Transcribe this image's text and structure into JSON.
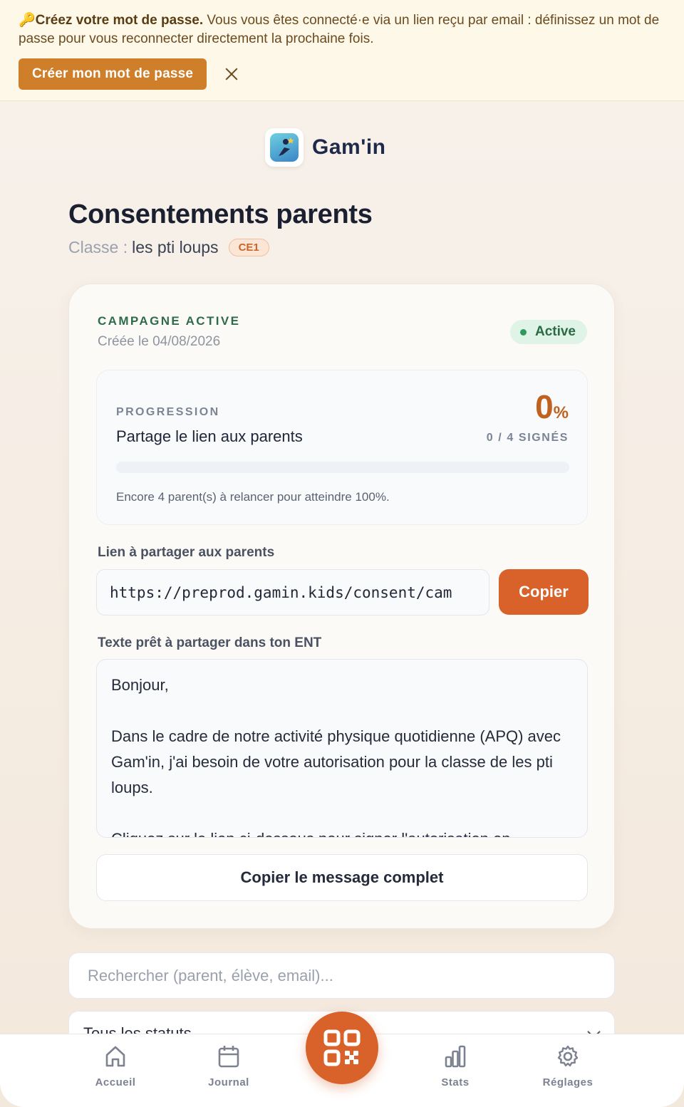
{
  "banner": {
    "emoji": "🔑",
    "title": "Créez votre mot de passe.",
    "text": " Vous vous êtes connecté·e via un lien reçu par email : définissez un mot de passe pour vous reconnecter directement la prochaine fois.",
    "button": "Créer mon mot de passe"
  },
  "logo": {
    "name": "Gam'in"
  },
  "page": {
    "title": "Consentements parents",
    "class_prefix": "Classe :",
    "class_name": "les pti loups",
    "class_level": "CE1"
  },
  "campaign": {
    "label": "CAMPAGNE ACTIVE",
    "created": "Créée le 04/08/2026",
    "status": "Active",
    "progress": {
      "label": "PROGRESSION",
      "title": "Partage le lien aux parents",
      "percent": "0",
      "percent_sign": "%",
      "fraction": 0,
      "count": "0 / 4 SIGNÉS",
      "hint": "Encore 4 parent(s) à relancer pour atteindre 100%."
    },
    "link_label": "Lien à partager aux parents",
    "link_value": "https://preprod.gamin.kids/consent/cam",
    "copy_button": "Copier",
    "text_label": "Texte prêt à partager dans ton ENT",
    "message": "Bonjour,\n\nDans le cadre de notre activité physique quotidienne (APQ) avec Gam'in, j'ai besoin de votre autorisation pour la classe de les pti loups.\n\nCliquez sur le lien ci-dessous pour signer l'autorisation en",
    "copy_message_button": "Copier le message complet"
  },
  "search": {
    "placeholder": "Rechercher (parent, élève, email)..."
  },
  "filter": {
    "value": "Tous les statuts"
  },
  "nav": {
    "home": "Accueil",
    "journal": "Journal",
    "stats": "Stats",
    "settings": "Réglages"
  },
  "colors": {
    "accent": "#d9622b",
    "banner_button": "#cf7e2a",
    "active_green": "#2a6b46"
  },
  "icons": [
    "key-icon",
    "close-icon",
    "logo-icon",
    "home-icon",
    "calendar-icon",
    "qr-code-icon",
    "bar-chart-icon",
    "gear-icon",
    "chevron-down-icon"
  ]
}
